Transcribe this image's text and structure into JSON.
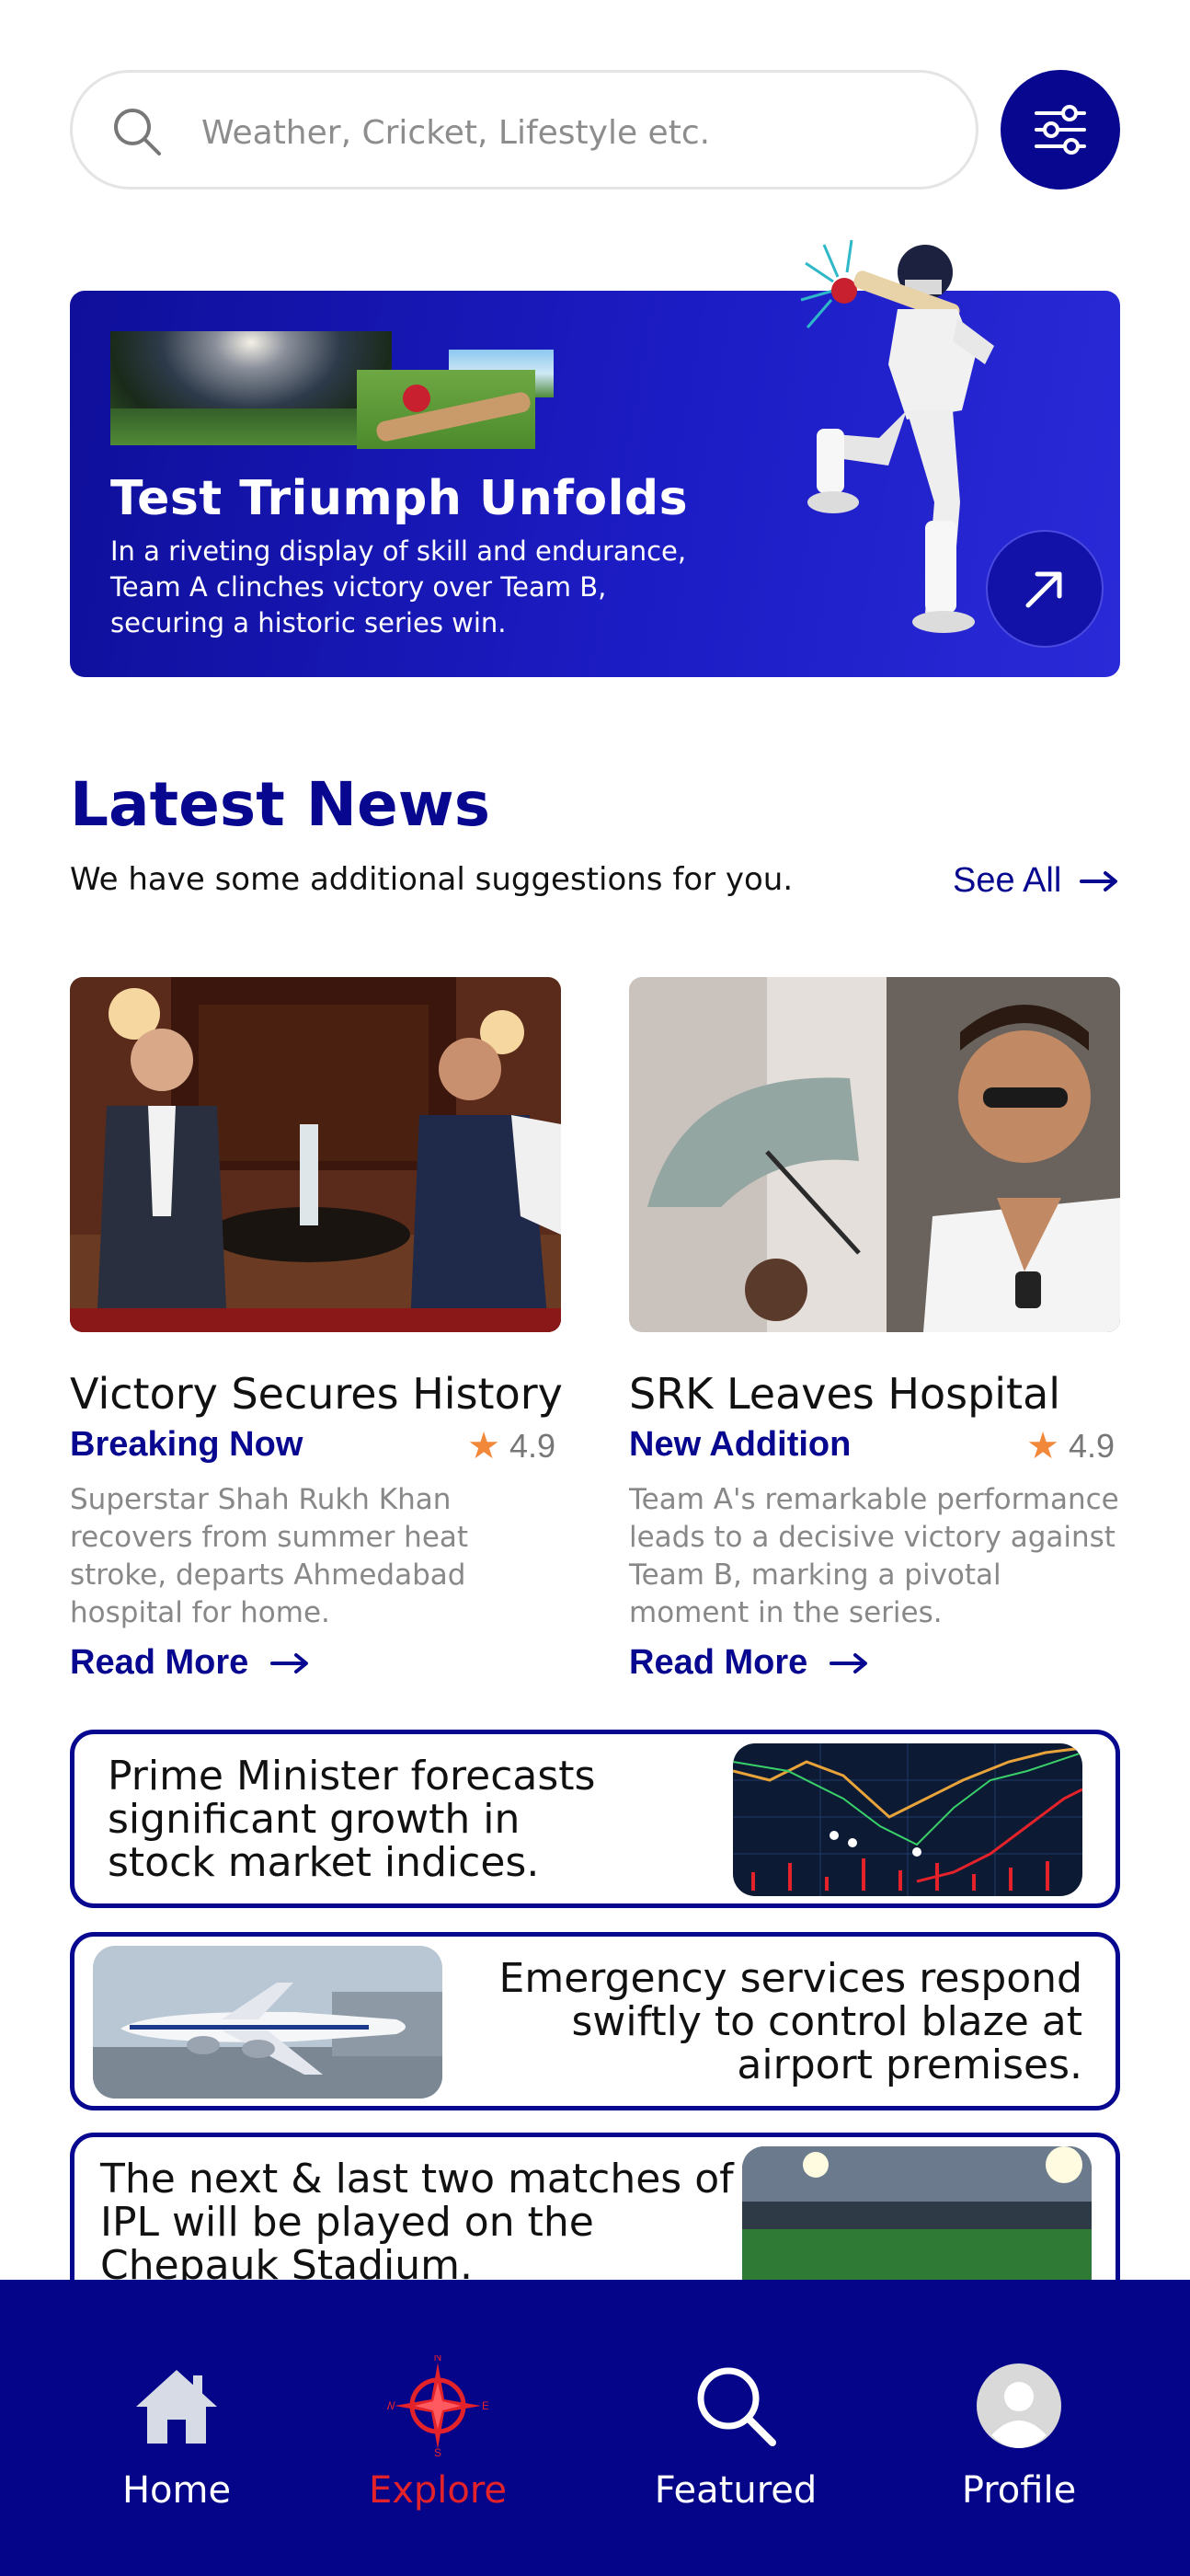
{
  "search": {
    "placeholder": "Weather, Cricket, Lifestyle etc.",
    "icon": "search-icon",
    "filter_icon": "sliders-icon"
  },
  "hero": {
    "title": "Test Triumph Unfolds",
    "description": "In a riveting display of skill and endurance, Team A clinches victory over Team B, securing a historic series win.",
    "arrow_icon": "arrow-up-right-icon"
  },
  "latest": {
    "title": "Latest News",
    "subtitle": "We have some additional suggestions for you.",
    "see_all": "See All"
  },
  "cards": [
    {
      "title": "Victory Secures History",
      "tag": "Breaking Now",
      "rating": "4.9",
      "description": "Superstar Shah Rukh Khan recovers from summer heat stroke, departs Ahmedabad hospital for home.",
      "read_more": "Read More"
    },
    {
      "title": "SRK Leaves Hospital",
      "tag": "New Addition",
      "rating": "4.9",
      "description": "Team A's remarkable performance leads to a decisive victory against Team B, marking a pivotal moment in the series.",
      "read_more": "Read More"
    }
  ],
  "list_items": [
    {
      "text": "Prime Minister forecasts significant growth in stock market indices."
    },
    {
      "text": "Emergency services respond swiftly to control blaze at airport premises."
    },
    {
      "text": "The next & last two matches of IPL will be played on the Chepauk Stadium."
    }
  ],
  "nav": [
    {
      "label": "Home",
      "icon": "home-icon"
    },
    {
      "label": "Explore",
      "icon": "compass-icon",
      "active": true
    },
    {
      "label": "Featured",
      "icon": "search-icon"
    },
    {
      "label": "Profile",
      "icon": "user-avatar-icon"
    }
  ],
  "colors": {
    "primary": "#07078f",
    "accent_red": "#e3222a",
    "star": "#f2883a"
  }
}
